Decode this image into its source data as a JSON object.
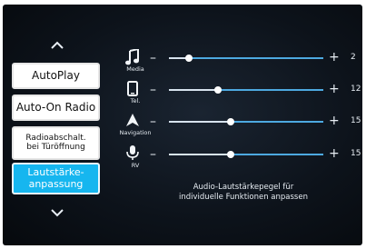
{
  "sidebar": {
    "scroll_up_icon": "chevron-up-icon",
    "scroll_down_icon": "chevron-down-icon",
    "buttons": [
      {
        "label": "AutoPlay",
        "active": false
      },
      {
        "label": "Auto-On Radio",
        "active": false
      },
      {
        "label_line1": "Radioabschalt.",
        "label_line2": "bei Türöffnung",
        "active": false
      },
      {
        "label_line1": "Lautstärke-",
        "label_line2": "anpassung",
        "active": true
      }
    ]
  },
  "sliders": [
    {
      "icon": "music-note-icon",
      "caption": "Media",
      "value": "2",
      "level": 0.13
    },
    {
      "icon": "phone-icon",
      "caption": "Tel.",
      "value": "12",
      "level": 0.32
    },
    {
      "icon": "navigation-arrow-icon",
      "caption": "Navigation",
      "value": "15",
      "level": 0.4
    },
    {
      "icon": "microphone-icon",
      "caption": "RV",
      "value": "15",
      "level": 0.4
    }
  ],
  "controls": {
    "minus": "–",
    "plus": "+"
  },
  "description": {
    "line1": "Audio-Lautstärkepegel für",
    "line2": "individuelle Funktionen anpassen"
  },
  "colors": {
    "background": "#0d131b",
    "accent": "#16b6ef",
    "track": "#4da9e0",
    "button_bg": "#ffffff"
  }
}
